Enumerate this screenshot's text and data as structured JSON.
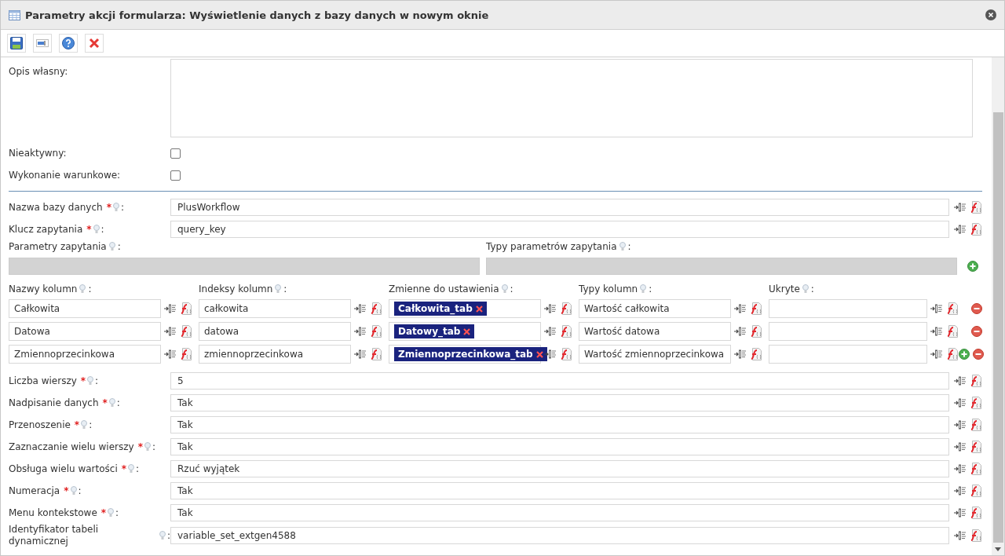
{
  "window": {
    "title": "Parametry akcji formularza: Wyświetlenie danych z bazy danych w nowym oknie"
  },
  "toolbar": [
    {
      "kind": "save"
    },
    {
      "kind": "field"
    },
    {
      "kind": "help"
    },
    {
      "kind": "delete"
    }
  ],
  "marks": {
    "required": "*",
    "colon": ":"
  },
  "description": {
    "label": "Opis własny:"
  },
  "checkboxes": [
    {
      "label": "Nieaktywny:",
      "checked": false
    },
    {
      "label": "Wykonanie warunkowe:",
      "checked": false
    }
  ],
  "fields_top": [
    {
      "label": "Nazwa bazy danych",
      "required": true,
      "value": "PlusWorkflow"
    },
    {
      "label": "Klucz zapytania",
      "required": true,
      "value": "query_key"
    }
  ],
  "query_params": {
    "left_label": "Parametry zapytania",
    "right_label": "Typy parametrów zapytania"
  },
  "columns": {
    "headers": [
      "Nazwy kolumn",
      "Indeksy kolumn",
      "Zmienne do ustawienia",
      "Typy kolumn",
      "Ukryte"
    ],
    "rows": [
      {
        "can_add": false,
        "cells": [
          {
            "kind": "text",
            "value": "Całkowita"
          },
          {
            "kind": "text",
            "value": "całkowita"
          },
          {
            "kind": "chip",
            "value": "Całkowita_tab"
          },
          {
            "kind": "text",
            "value": "Wartość całkowita"
          },
          {
            "kind": "text"
          }
        ]
      },
      {
        "can_add": false,
        "cells": [
          {
            "kind": "text",
            "value": "Datowa"
          },
          {
            "kind": "text",
            "value": "datowa"
          },
          {
            "kind": "chip",
            "value": "Datowy_tab"
          },
          {
            "kind": "text",
            "value": "Wartość datowa"
          },
          {
            "kind": "text"
          }
        ]
      },
      {
        "can_add": true,
        "cells": [
          {
            "kind": "text",
            "value": "Zmiennoprzecinkowa"
          },
          {
            "kind": "text",
            "value": "zmiennoprzecinkowa"
          },
          {
            "kind": "chip",
            "value": "Zmiennoprzecinkowa_tab"
          },
          {
            "kind": "text",
            "value": "Wartość zmiennoprzecinkowa"
          },
          {
            "kind": "text"
          }
        ]
      }
    ]
  },
  "fields_bottom": [
    {
      "label": "Liczba wierszy",
      "required": true,
      "value": "5"
    },
    {
      "label": "Nadpisanie danych",
      "required": true,
      "value": "Tak"
    },
    {
      "label": "Przenoszenie",
      "required": true,
      "value": "Tak"
    },
    {
      "label": "Zaznaczanie wielu wierszy",
      "required": true,
      "value": "Tak"
    },
    {
      "label": "Obsługa wielu wartości",
      "required": true,
      "value": "Rzuć wyjątek"
    },
    {
      "label": "Numeracja",
      "required": true,
      "value": "Tak"
    },
    {
      "label": "Menu kontekstowe",
      "required": true,
      "value": "Tak"
    },
    {
      "label": "Identyfikator tabeli dynamicznej",
      "required": false,
      "value": "variable_set_extgen4588"
    }
  ]
}
